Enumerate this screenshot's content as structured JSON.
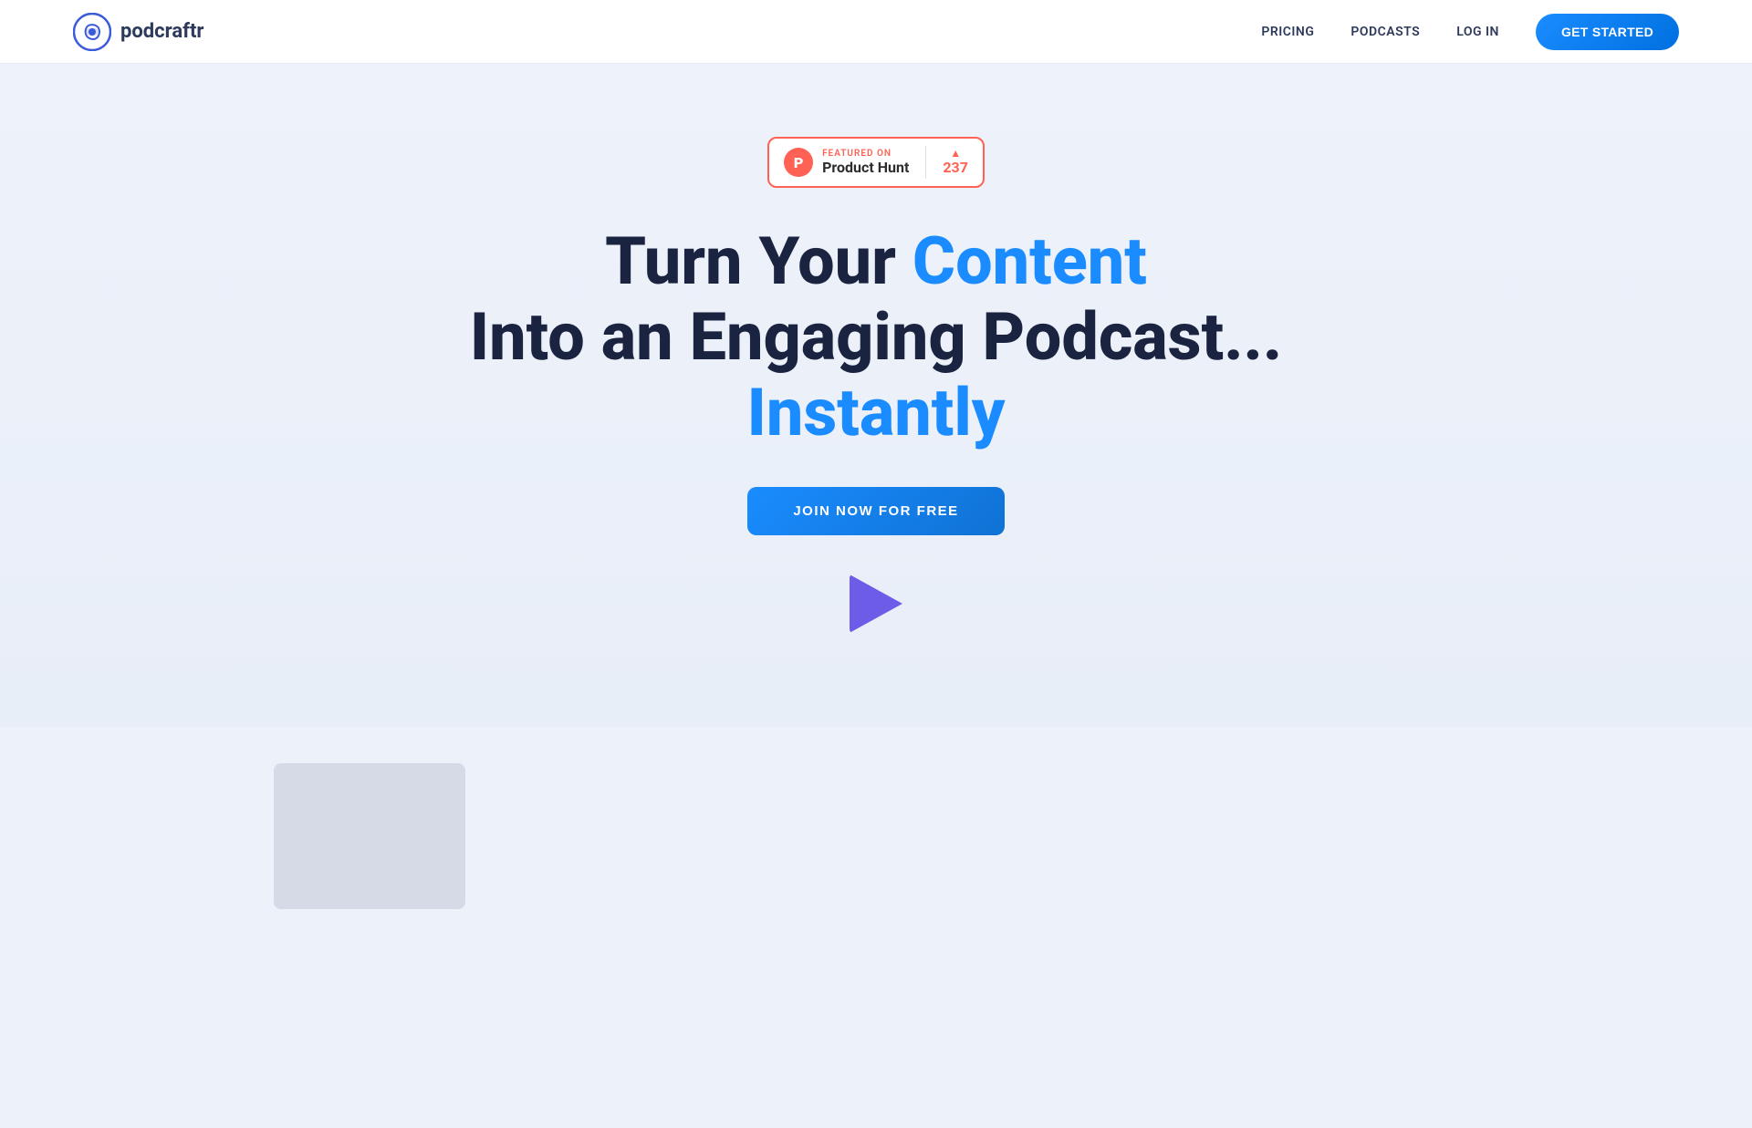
{
  "nav": {
    "logo_text": "podcraftr",
    "links": [
      {
        "label": "PRICING",
        "id": "pricing"
      },
      {
        "label": "PODCASTS",
        "id": "podcasts"
      },
      {
        "label": "LOG IN",
        "id": "login"
      }
    ],
    "cta_label": "GET STARTED"
  },
  "product_hunt": {
    "featured_label": "FEATURED ON",
    "name": "Product Hunt",
    "votes": "237",
    "p_letter": "P"
  },
  "hero": {
    "line1_plain": "Turn Your ",
    "line1_highlight": "Content",
    "line2": "Into an Engaging Podcast...",
    "line3_highlight": "Instantly",
    "cta_label": "JOIN NOW FOR FREE"
  },
  "colors": {
    "accent_blue": "#1a8cff",
    "accent_dark": "#1a2340",
    "product_hunt_red": "#ff6154",
    "play_purple": "#6c5ce7"
  }
}
